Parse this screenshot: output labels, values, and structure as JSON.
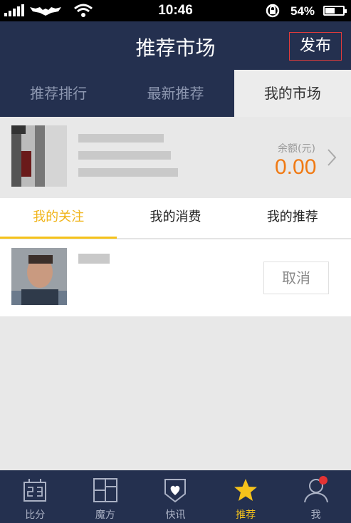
{
  "status_bar": {
    "time": "10:46",
    "battery": "54%",
    "battery_level": 0.54
  },
  "header": {
    "title": "推荐市场",
    "publish_label": "发布"
  },
  "top_tabs": [
    {
      "label": "推荐排行",
      "active": false
    },
    {
      "label": "最新推荐",
      "active": false
    },
    {
      "label": "我的市场",
      "active": true
    }
  ],
  "account": {
    "balance_label": "余额(元)",
    "balance_value": "0.00"
  },
  "sub_tabs": [
    {
      "label": "我的关注",
      "active": true
    },
    {
      "label": "我的消费",
      "active": false
    },
    {
      "label": "我的推荐",
      "active": false
    }
  ],
  "follow_list": {
    "cancel_label": "取消"
  },
  "tab_bar": [
    {
      "label": "比分",
      "icon": "scoreboard-icon",
      "active": false
    },
    {
      "label": "魔方",
      "icon": "cube-icon",
      "active": false
    },
    {
      "label": "快讯",
      "icon": "news-shield-icon",
      "active": false
    },
    {
      "label": "推荐",
      "icon": "star-icon",
      "active": true
    },
    {
      "label": "我",
      "icon": "person-icon",
      "active": false
    }
  ],
  "colors": {
    "header_bg": "#24304f",
    "accent_yellow": "#f5c21b",
    "balance_orange": "#f07a14",
    "badge_red": "#e53333"
  }
}
